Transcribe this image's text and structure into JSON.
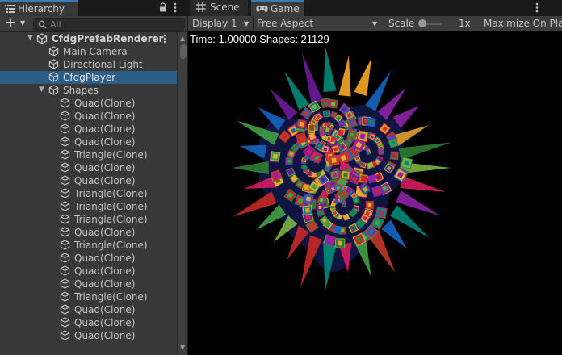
{
  "hierarchy": {
    "tab_label": "Hierarchy",
    "search_placeholder": "All",
    "scene_name": "CfdgPrefabRenderer",
    "rows": [
      {
        "label": "Main Camera",
        "indent": 1,
        "selected": false
      },
      {
        "label": "Directional Light",
        "indent": 1,
        "selected": false
      },
      {
        "label": "CfdgPlayer",
        "indent": 1,
        "selected": true
      },
      {
        "label": "Shapes",
        "indent": 1,
        "selected": false,
        "expanded": true
      },
      {
        "label": "Quad(Clone)",
        "indent": 2
      },
      {
        "label": "Quad(Clone)",
        "indent": 2
      },
      {
        "label": "Quad(Clone)",
        "indent": 2
      },
      {
        "label": "Quad(Clone)",
        "indent": 2
      },
      {
        "label": "Triangle(Clone)",
        "indent": 2
      },
      {
        "label": "Quad(Clone)",
        "indent": 2
      },
      {
        "label": "Quad(Clone)",
        "indent": 2
      },
      {
        "label": "Triangle(Clone)",
        "indent": 2
      },
      {
        "label": "Triangle(Clone)",
        "indent": 2
      },
      {
        "label": "Triangle(Clone)",
        "indent": 2
      },
      {
        "label": "Quad(Clone)",
        "indent": 2
      },
      {
        "label": "Triangle(Clone)",
        "indent": 2
      },
      {
        "label": "Quad(Clone)",
        "indent": 2
      },
      {
        "label": "Quad(Clone)",
        "indent": 2
      },
      {
        "label": "Quad(Clone)",
        "indent": 2
      },
      {
        "label": "Triangle(Clone)",
        "indent": 2
      },
      {
        "label": "Quad(Clone)",
        "indent": 2
      },
      {
        "label": "Quad(Clone)",
        "indent": 2
      },
      {
        "label": "Quad(Clone)",
        "indent": 2
      }
    ]
  },
  "tabs": {
    "scene_label": "Scene",
    "game_label": "Game"
  },
  "game_toolbar": {
    "display": "Display 1",
    "aspect": "Free Aspect",
    "scale_label": "Scale",
    "scale_value": "1x",
    "scale_level": 0,
    "maximize_label": "Maximize On Pla"
  },
  "stats": {
    "text": "Time: 1.00000 Shapes: 21129"
  },
  "colors": {
    "selection": "#2c5d87",
    "accent": "#3a79bb",
    "panel": "#383838",
    "background": "#000000"
  },
  "icons": {
    "hierarchy_tab": "hierarchy-list-icon",
    "lock": "lock-icon",
    "menu": "kebab-menu-icon",
    "create": "plus-icon",
    "search": "search-icon",
    "scene_asset": "unity-logo-icon",
    "game_object": "cube-icon",
    "scene_tab": "grid-icon",
    "game_tab": "gamepad-icon"
  }
}
